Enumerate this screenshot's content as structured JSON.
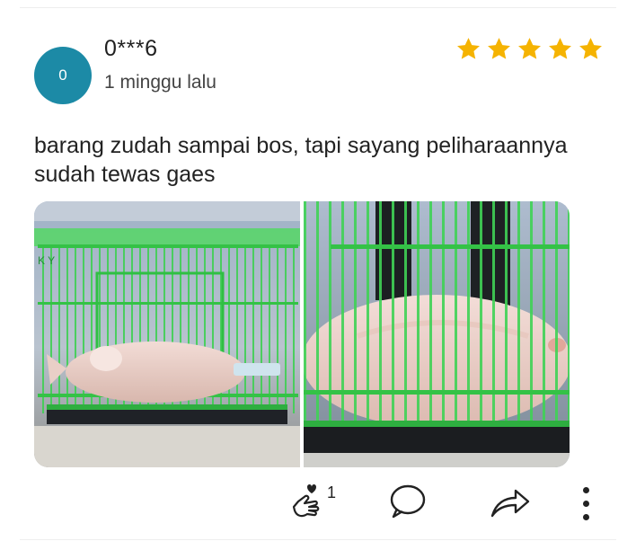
{
  "review": {
    "avatar_initial": "0",
    "username": "0***6",
    "timestamp": "1 minggu lalu",
    "rating": 5,
    "text": "barang zudah sampai bos, tapi sayang peliharaannya sudah tewas gaes"
  },
  "photos": [
    {
      "icon": "photo-fish-in-cage-wide"
    },
    {
      "icon": "photo-fish-in-cage-closeup"
    }
  ],
  "actions": {
    "like_count": "1",
    "like_icon": "finger-heart-icon",
    "comment_icon": "comment-icon",
    "share_icon": "share-icon",
    "more_icon": "more-vertical-icon"
  },
  "colors": {
    "avatar": "#1c8aa6",
    "star": "#f5b301",
    "cage_green": "#35c24a"
  }
}
